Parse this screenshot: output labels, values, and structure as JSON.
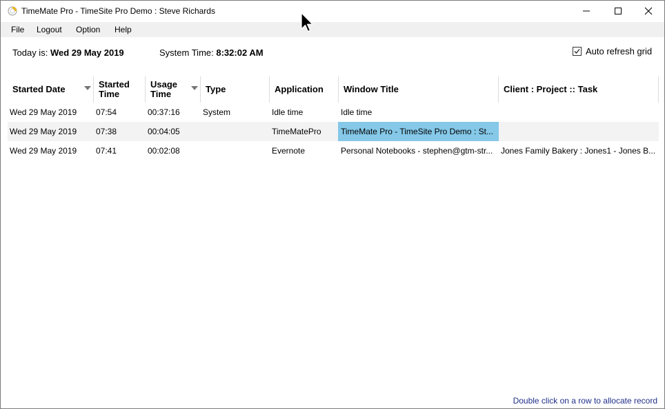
{
  "window": {
    "title": "TimeMate Pro - TimeSite Pro Demo : Steve Richards"
  },
  "menu": [
    "File",
    "Logout",
    "Option",
    "Help"
  ],
  "info": {
    "today_label": "Today is:",
    "today_value": "Wed 29 May 2019",
    "system_time_label": "System Time:",
    "system_time_value": "8:32:02 AM"
  },
  "auto_refresh": {
    "label": "Auto refresh grid",
    "checked": true
  },
  "grid": {
    "columns": [
      {
        "label": "Started Date",
        "sorted": true
      },
      {
        "label": "Started Time",
        "sorted": false
      },
      {
        "label": "Usage Time",
        "sorted": true
      },
      {
        "label": "Type",
        "sorted": false
      },
      {
        "label": "Application",
        "sorted": false
      },
      {
        "label": "Window Title",
        "sorted": false
      },
      {
        "label": "Client : Project :: Task",
        "sorted": false
      }
    ],
    "rows": [
      [
        "Wed 29 May 2019",
        "07:54",
        "00:37:16",
        "System",
        "Idle time",
        "Idle time",
        ""
      ],
      [
        "Wed 29 May 2019",
        "07:38",
        "00:04:05",
        "",
        "TimeMatePro",
        "TimeMate Pro - TimeSite Pro Demo : St...",
        ""
      ],
      [
        "Wed 29 May 2019",
        "07:41",
        "00:02:08",
        "",
        "Evernote",
        "Personal Notebooks - stephen@gtm-str...",
        "Jones Family Bakery : Jones1 - Jones B..."
      ]
    ],
    "selected_row": 1,
    "selected_column": 5
  },
  "footer": {
    "hint": "Double click on a row to allocate record"
  }
}
